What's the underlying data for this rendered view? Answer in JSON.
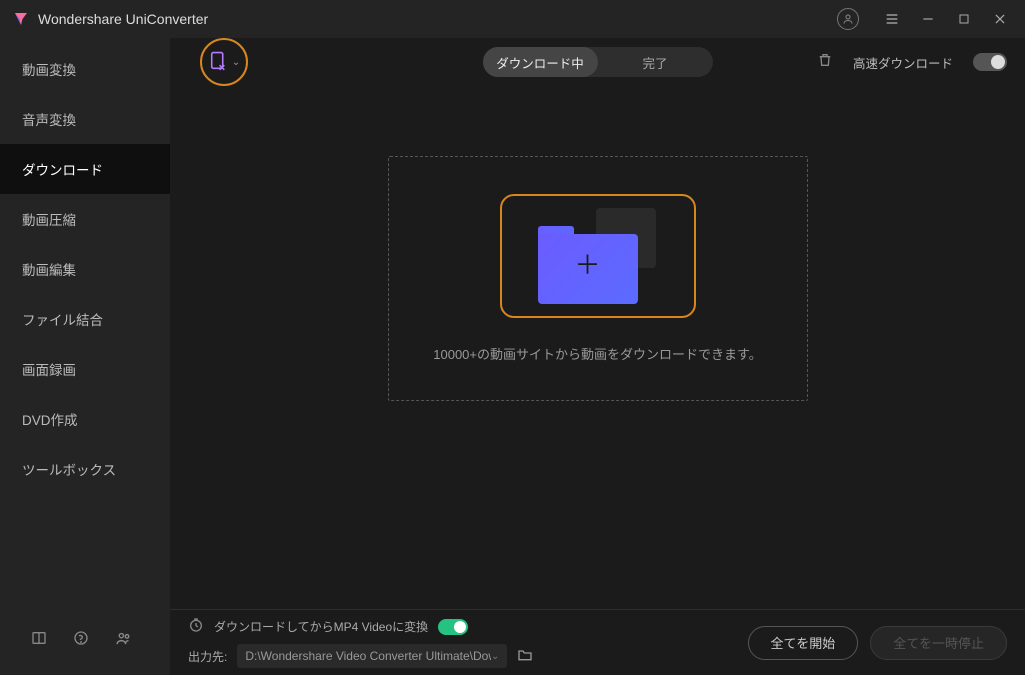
{
  "app_title": "Wondershare UniConverter",
  "sidebar": {
    "items": [
      {
        "label": "動画変換"
      },
      {
        "label": "音声変換"
      },
      {
        "label": "ダウンロード"
      },
      {
        "label": "動画圧縮"
      },
      {
        "label": "動画編集"
      },
      {
        "label": "ファイル結合"
      },
      {
        "label": "画面録画"
      },
      {
        "label": "DVD作成"
      },
      {
        "label": "ツールボックス"
      }
    ],
    "active_index": 2
  },
  "tabs": {
    "downloading": "ダウンロード中",
    "completed": "完了",
    "active": "downloading"
  },
  "toolbar": {
    "fast_download_label": "高速ダウンロード",
    "fast_download_on": false
  },
  "dropzone": {
    "text": "10000+の動画サイトから動画をダウンロードできます。"
  },
  "footer": {
    "convert_after_label": "ダウンロードしてからMP4 Videoに変換",
    "convert_after_on": true,
    "output_label": "出力先:",
    "output_path": "D:\\Wondershare Video Converter Ultimate\\Dow",
    "start_all": "全てを開始",
    "pause_all": "全てを一時停止"
  }
}
